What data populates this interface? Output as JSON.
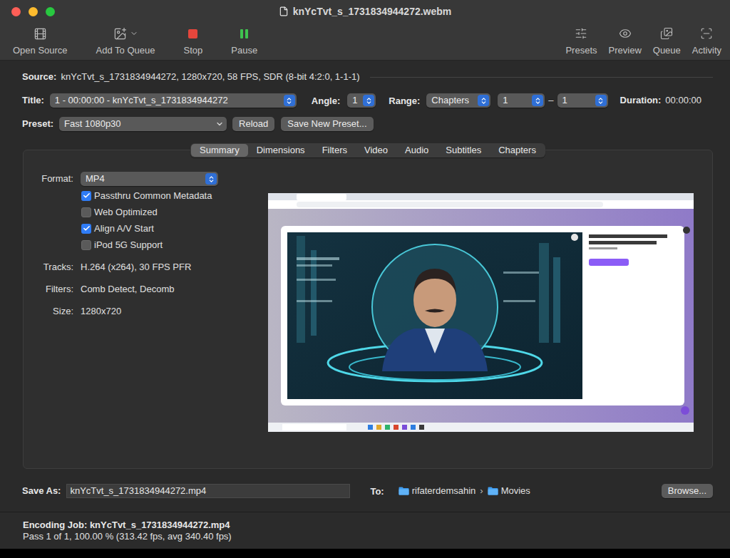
{
  "window": {
    "title": "knYcTvt_s_1731834944272.webm"
  },
  "toolbar": {
    "left": [
      {
        "label": "Open Source",
        "kind": "button"
      },
      {
        "label": "Add To Queue",
        "kind": "menu"
      },
      {
        "label": "Stop",
        "kind": "button"
      },
      {
        "label": "Pause",
        "kind": "button"
      }
    ],
    "right": [
      {
        "label": "Presets"
      },
      {
        "label": "Preview"
      },
      {
        "label": "Queue"
      },
      {
        "label": "Activity"
      }
    ]
  },
  "source": {
    "label": "Source:",
    "value": "knYcTvt_s_1731834944272, 1280x720, 58 FPS, SDR (8-bit 4:2:0, 1-1-1)"
  },
  "title_row": {
    "title": {
      "label": "Title:",
      "value": "1 - 00:00:00 - knYcTvt_s_1731834944272"
    },
    "angle": {
      "label": "Angle:",
      "value": "1"
    },
    "range": {
      "label": "Range:",
      "value": "Chapters",
      "from": "1",
      "separator": "–",
      "to": "1"
    },
    "duration": {
      "label": "Duration:",
      "value": "00:00:00"
    }
  },
  "preset": {
    "label": "Preset:",
    "value": "Fast 1080p30",
    "buttons": [
      "Reload",
      "Save New Preset..."
    ]
  },
  "tabs": [
    {
      "label": "Summary",
      "selected": true
    },
    {
      "label": "Dimensions",
      "selected": false
    },
    {
      "label": "Filters",
      "selected": false
    },
    {
      "label": "Video",
      "selected": false
    },
    {
      "label": "Audio",
      "selected": false
    },
    {
      "label": "Subtitles",
      "selected": false
    },
    {
      "label": "Chapters",
      "selected": false
    }
  ],
  "summary": {
    "format": {
      "label": "Format:",
      "value": "MP4"
    },
    "options": [
      {
        "label": "Passthru Common Metadata",
        "checked": true
      },
      {
        "label": "Web Optimized",
        "checked": false
      },
      {
        "label": "Align A/V Start",
        "checked": true
      },
      {
        "label": "iPod 5G Support",
        "checked": false
      }
    ],
    "info": [
      {
        "label": "Tracks:",
        "value": "H.264 (x264), 30 FPS PFR"
      },
      {
        "label": "Filters:",
        "value": "Comb Detect, Decomb"
      },
      {
        "label": "Size:",
        "value": "1280x720"
      }
    ]
  },
  "save": {
    "label": "Save As:",
    "value": "knYcTvt_s_1731834944272.mp4",
    "to_label": "To:",
    "path": [
      "rifaterdemsahin",
      "Movies"
    ],
    "path_separator": "›",
    "button": "Browse..."
  },
  "status": {
    "job": "Encoding Job: knYcTvt_s_1731834944272.mp4",
    "progress": "Pass 1 of 1, 100.00 % (313.42 fps, avg 340.40 fps)"
  }
}
